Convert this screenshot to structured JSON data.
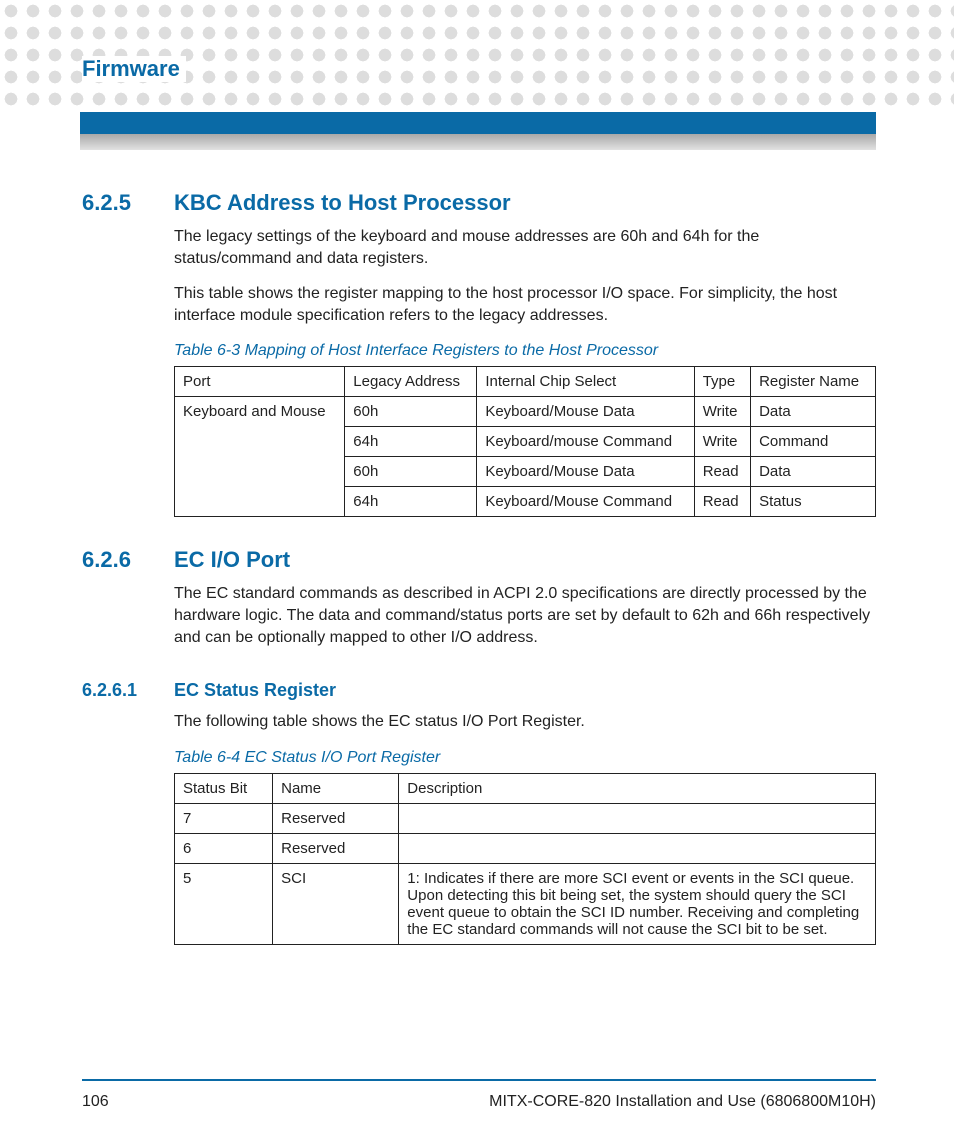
{
  "header": {
    "chapter": "Firmware"
  },
  "section_625": {
    "num": "6.2.5",
    "title": "KBC Address to Host Processor",
    "p1": "The legacy settings of the keyboard and mouse addresses are 60h and 64h for the status/command and data registers.",
    "p2": "This table shows the register mapping to the host processor I/O space. For simplicity, the host interface module specification refers to the legacy addresses."
  },
  "table_63": {
    "caption": "Table 6-3 Mapping of Host Interface Registers to the Host Processor",
    "headers": [
      "Port",
      "Legacy Address",
      "Internal Chip Select",
      "Type",
      "Register Name"
    ],
    "port_cell": "Keyboard and Mouse",
    "rows": [
      [
        "60h",
        "Keyboard/Mouse Data",
        "Write",
        "Data"
      ],
      [
        "64h",
        "Keyboard/mouse Command",
        "Write",
        "Command"
      ],
      [
        "60h",
        "Keyboard/Mouse Data",
        "Read",
        "Data"
      ],
      [
        "64h",
        "Keyboard/Mouse Command",
        "Read",
        "Status"
      ]
    ]
  },
  "section_626": {
    "num": "6.2.6",
    "title": "EC I/O Port",
    "p1": "The EC standard commands as described in ACPI 2.0 specifications are directly processed by the hardware logic. The data and command/status ports are set by default to 62h and 66h respectively and can be optionally mapped to other I/O address."
  },
  "section_6261": {
    "num": "6.2.6.1",
    "title": "EC Status Register",
    "p1": "The following table shows the EC status I/O Port Register."
  },
  "table_64": {
    "caption": "Table 6-4 EC Status I/O Port Register",
    "headers": [
      "Status Bit",
      "Name",
      "Description"
    ],
    "rows": [
      [
        "7",
        "Reserved",
        ""
      ],
      [
        "6",
        "Reserved",
        ""
      ],
      [
        "5",
        "SCI",
        "1: Indicates if there are more SCI event or events in the SCI queue. Upon detecting this bit being set, the system should query the SCI event queue to obtain the SCI ID number. Receiving and completing the EC standard commands will not cause the SCI bit to be set."
      ]
    ]
  },
  "footer": {
    "page": "106",
    "doc": "MITX-CORE-820 Installation and Use (6806800M10H)"
  }
}
